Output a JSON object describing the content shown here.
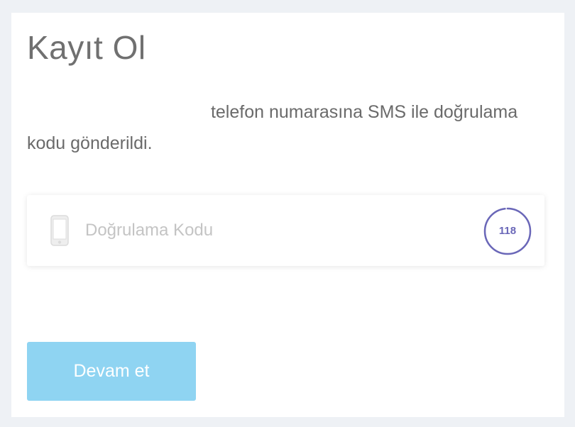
{
  "form": {
    "title": "Kayıt Ol",
    "sms_message": "telefon numarasına SMS ile doğrulama kodu gönderildi."
  },
  "code_field": {
    "placeholder": "Doğrulama Kodu",
    "value": "",
    "icon": "mobile-phone-icon"
  },
  "timer": {
    "seconds": "118",
    "progress": 0.98,
    "color": "#6a67b8"
  },
  "button": {
    "label": "Devam et",
    "color": "#8fd4f2"
  }
}
